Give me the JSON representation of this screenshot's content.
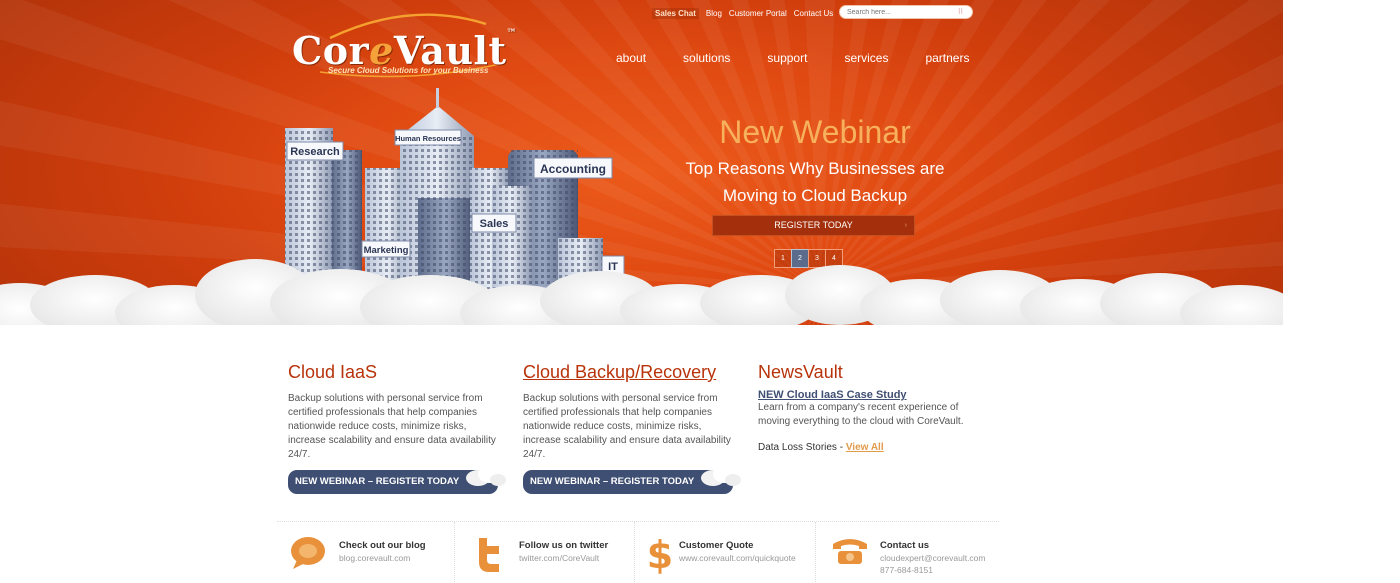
{
  "brand": {
    "logo_word_prefix": "Cor",
    "logo_word_e": "e",
    "logo_word_suffix": "Vault",
    "logo_tm": "™",
    "tagline": "Secure Cloud Solutions for your Business",
    "accent": "#b8330a",
    "hero_orange": "#e04a12",
    "navy": "#3f4f73"
  },
  "utility_nav": {
    "sales_chat": "Sales Chat",
    "blog": "Blog",
    "customer_portal": "Customer Portal",
    "contact_us": "Contact Us"
  },
  "search": {
    "placeholder": "Search here..."
  },
  "main_nav": [
    "about",
    "solutions",
    "support",
    "services",
    "partners"
  ],
  "hero": {
    "building_labels": [
      "Research",
      "Human Resources",
      "Accounting",
      "Sales",
      "Marketing",
      "IT"
    ],
    "headline": "New Webinar",
    "subline_1": "Top Reasons Why Businesses are",
    "subline_2": "Moving to Cloud Backup",
    "cta": "REGISTER TODAY",
    "cta_arrow": "›",
    "pager": [
      "1",
      "2",
      "3",
      "4"
    ],
    "pager_active": "2"
  },
  "columns": [
    {
      "title": "Cloud IaaS",
      "body": "Backup solutions with personal service from certified professionals that help companies nationwide reduce costs, minimize risks, increase scalability and ensure data availability 24/7.",
      "button": "NEW WEBINAR – REGISTER TODAY"
    },
    {
      "title": "Cloud Backup/Recovery",
      "body": "Backup solutions with personal service from certified professionals that help companies nationwide reduce costs, minimize risks, increase scalability and ensure data availability 24/7.",
      "button": "NEW WEBINAR – REGISTER TODAY"
    }
  ],
  "newsvault": {
    "title": "NewsVault",
    "case_study_link": "NEW Cloud IaaS Case Study",
    "case_study_body": "Learn from a company's recent experience of moving everything to the cloud with CoreVault.",
    "loss_label": "Data Loss Stories - ",
    "view_all": "View All"
  },
  "footer": [
    {
      "icon": "speech-bubble-icon",
      "title": "Check out our blog",
      "sub": "blog.corevault.com"
    },
    {
      "icon": "twitter-bird-icon",
      "title": "Follow us on twitter",
      "sub": "twitter.com/CoreVault"
    },
    {
      "icon": "dollar-sign-icon",
      "title": "Customer Quote",
      "sub": "www.corevault.com/quickquote"
    },
    {
      "icon": "telephone-icon",
      "title": "Contact us",
      "sub": "cloudexpert@corevault.com",
      "sub2": "877-684-8151"
    }
  ]
}
